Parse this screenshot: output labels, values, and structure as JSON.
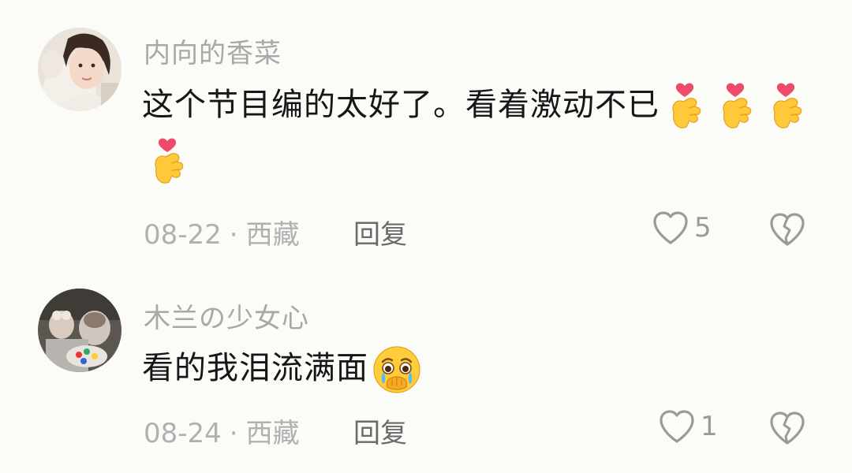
{
  "comments": [
    {
      "username": "内向的香菜",
      "text": "这个节目编的太好了。看着激动不已",
      "date": "08-22",
      "location": "西藏",
      "reply_label": "回复",
      "likes": "5",
      "emojis": [
        "heart-hands-emoji",
        "heart-hands-emoji",
        "heart-hands-emoji",
        "heart-hands-emoji"
      ]
    },
    {
      "username": "木兰の少女心",
      "text": "看的我泪流满面",
      "date": "08-24",
      "location": "西藏",
      "reply_label": "回复",
      "likes": "1",
      "emojis": [
        "crying-face-emoji"
      ]
    }
  ],
  "separator": "·",
  "colors": {
    "background": "#fbfbf8",
    "username": "#a8a8a8",
    "text": "#161616",
    "meta": "#b0b0b0",
    "icon": "#9a9a9a"
  }
}
